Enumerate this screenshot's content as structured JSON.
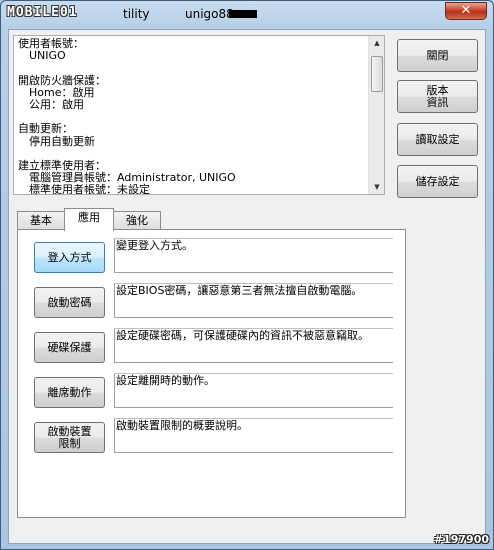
{
  "window": {
    "logo_text": "MOBILE01",
    "title_suffix": "tility",
    "title_user": "unigo88",
    "close_label": "✕"
  },
  "info": {
    "sections": [
      {
        "heading": "使用者帳號：",
        "lines": [
          "UNIGO"
        ]
      },
      {
        "heading": "開啟防火牆保護：",
        "lines": [
          "Home：啟用",
          "公用：啟用"
        ]
      },
      {
        "heading": "自動更新：",
        "lines": [
          "停用自動更新"
        ]
      },
      {
        "heading": "建立標準使用者：",
        "lines": [
          "電腦管理員帳號：Administrator, UNIGO",
          "標準使用者帳號：未設定"
        ]
      }
    ]
  },
  "side_buttons": [
    {
      "label": "關閉"
    },
    {
      "label": "版本\n資訊"
    },
    {
      "label": "讀取設定"
    },
    {
      "label": "儲存設定"
    }
  ],
  "tabs": [
    {
      "label": "基本"
    },
    {
      "label": "應用",
      "active": true
    },
    {
      "label": "強化"
    }
  ],
  "actions": [
    {
      "button": "登入方式",
      "desc": "變更登入方式。"
    },
    {
      "button": "啟動密碼",
      "desc": "設定BIOS密碼，讓惡意第三者無法擅自啟動電腦。"
    },
    {
      "button": "硬碟保護",
      "desc": "設定硬碟密碼，可保護硬碟內的資訊不被惡意竊取。"
    },
    {
      "button": "離席動作",
      "desc": "設定離開時的動作。"
    },
    {
      "button": "啟動裝置\n限制",
      "desc": "啟動裝置限制的概要說明。"
    }
  ],
  "watermark": "#197900"
}
